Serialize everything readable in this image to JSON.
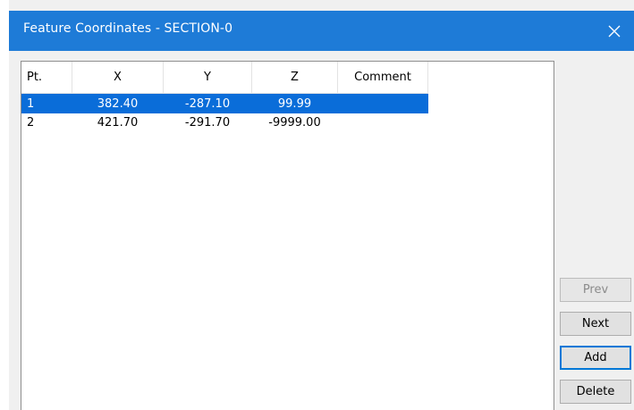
{
  "window": {
    "title": "Feature Coordinates - SECTION-0",
    "titlebar_color": "#1e7bd7"
  },
  "table": {
    "columns": [
      "Pt.",
      "X",
      "Y",
      "Z",
      "Comment"
    ],
    "rows": [
      {
        "pt": "1",
        "x": "382.40",
        "y": "-287.10",
        "z": "99.99",
        "comment": "",
        "selected": true
      },
      {
        "pt": "2",
        "x": "421.70",
        "y": "-291.70",
        "z": "-9999.00",
        "comment": "",
        "selected": false
      }
    ],
    "selection_color": "#0a6dd9"
  },
  "buttons": {
    "prev": "Prev",
    "next": "Next",
    "add": "Add",
    "delete": "Delete"
  }
}
